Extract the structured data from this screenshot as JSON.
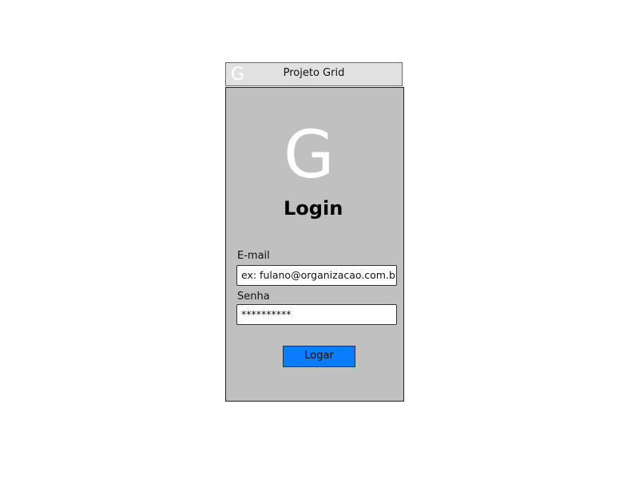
{
  "window": {
    "title": "Projeto Grid",
    "icon_letter": "G"
  },
  "login": {
    "logo_letter": "G",
    "heading": "Login",
    "email_label": "E-mail",
    "email_placeholder": "ex: fulano@organizacao.com.br",
    "password_label": "Senha",
    "password_value": "**********",
    "submit_label": "Logar"
  },
  "colors": {
    "panel_bg": "#c0c0c0",
    "titlebar_bg": "#e1e1e1",
    "button_bg": "#0a7cff"
  }
}
